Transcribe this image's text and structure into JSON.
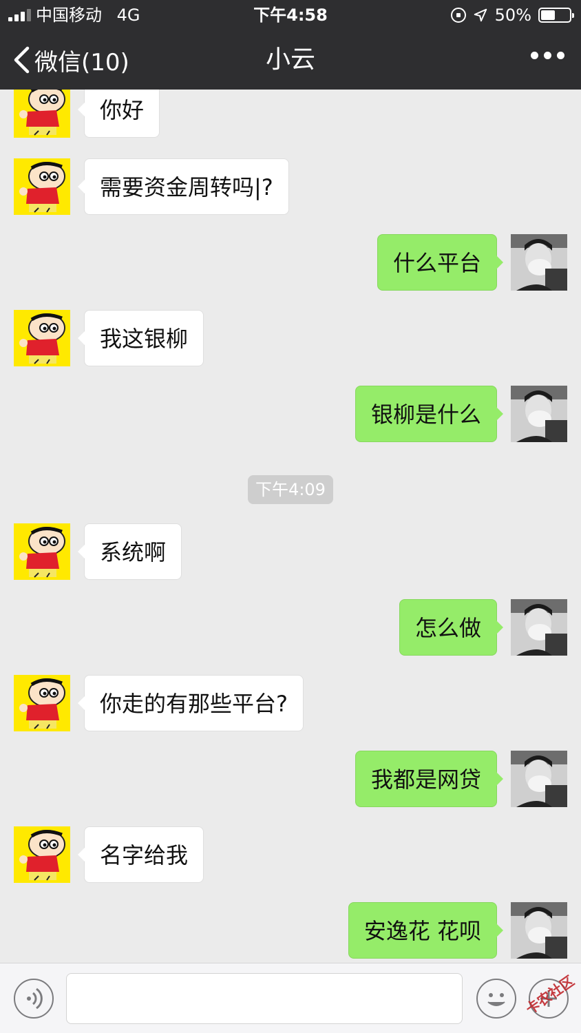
{
  "status_bar": {
    "carrier": "中国移动",
    "network": "4G",
    "time": "下午4:58",
    "battery_text": "50%",
    "battery_level": 0.5,
    "signal_bars_filled": 3,
    "signal_bars_total": 4
  },
  "nav": {
    "back_label": "微信(10)",
    "title": "小云"
  },
  "colors": {
    "header_bg": "#2e2e30",
    "chat_bg": "#ebebeb",
    "incoming_bubble": "#ffffff",
    "outgoing_bubble": "#95ec69",
    "incoming_avatar_bg": "#ffe900"
  },
  "messages": [
    {
      "from": "contact",
      "text": "你好"
    },
    {
      "from": "contact",
      "text": "需要资金周转吗|?"
    },
    {
      "from": "me",
      "text": "什么平台"
    },
    {
      "from": "contact",
      "text": "我这银柳"
    },
    {
      "from": "me",
      "text": "银柳是什么"
    },
    {
      "from": "contact",
      "text": "系统啊"
    },
    {
      "from": "me",
      "text": "怎么做"
    },
    {
      "from": "contact",
      "text": "你走的有那些平台?"
    },
    {
      "from": "me",
      "text": "我都是网贷"
    },
    {
      "from": "contact",
      "text": "名字给我"
    },
    {
      "from": "me",
      "text": "安逸花 花呗"
    }
  ],
  "time_divider": "下午4:09",
  "input_bar": {
    "voice_icon": "voice-icon",
    "emoji_icon": "emoji-icon",
    "plus_icon": "plus-icon",
    "value": ""
  },
  "watermark": "卡农社区"
}
